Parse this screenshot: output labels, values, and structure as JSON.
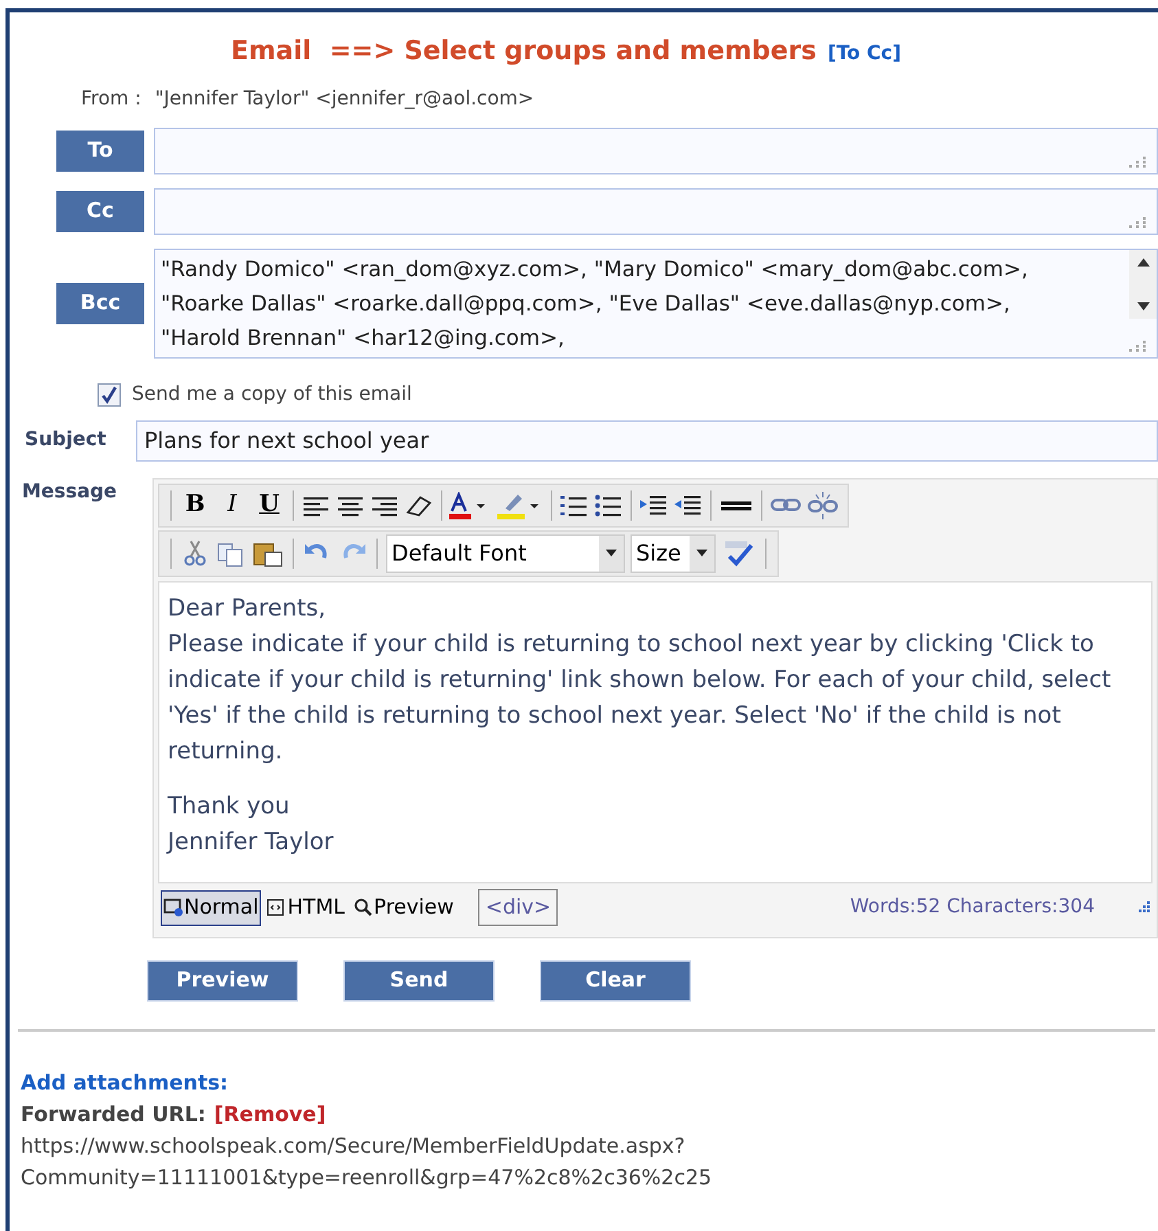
{
  "title": {
    "text": "Email  ==> Select groups and members",
    "link": "[To Cc]"
  },
  "from": {
    "label": "From :",
    "value": "\"Jennifer Taylor\" <jennifer_r@aol.com>"
  },
  "recipients": [
    {
      "label": "To"
    },
    {
      "label": "Cc"
    },
    {
      "label": "Bcc",
      "value": "\"Randy Domico\" <ran_dom@xyz.com>, \"Mary Domico\" <mary_dom@abc.com>, \"Roarke Dallas\" <roarke.dall@ppq.com>, \"Eve Dallas\" <eve.dallas@nyp.com>, \"Harold Brennan\" <har12@ing.com>,"
    }
  ],
  "copy_to_self": {
    "label": "Send me a copy of this email",
    "checked": true
  },
  "subject": {
    "label": "Subject",
    "value": "Plans for next school year"
  },
  "message": {
    "label": "Message",
    "format_buttons": [
      "B",
      "I",
      "U"
    ],
    "font_select": "Default Font",
    "size_select": "Size",
    "body": [
      "Dear Parents,",
      "Please indicate if your child is returning to school next year by clicking 'Click to indicate if your child is returning' link shown below. For each of your child, select 'Yes' if the child is returning to school next year. Select 'No' if the child is not returning.",
      "Thank you\nJennifer Taylor"
    ],
    "modes": [
      {
        "label": "Normal",
        "selected": true
      },
      {
        "label": "HTML",
        "selected": false
      },
      {
        "label": "Preview",
        "selected": false
      }
    ],
    "tag_path": "<div>",
    "counts": "Words:52 Characters:304"
  },
  "buttons": [
    "Preview",
    "Send",
    "Clear"
  ],
  "attachments": {
    "label": "Add attachments:",
    "forwarded_label": "Forwarded URL:",
    "remove_link": "[Remove]",
    "url_lines": [
      "https://www.schoolspeak.com/Secure/MemberFieldUpdate.aspx?",
      "Community=11111001&type=reenroll&grp=47%2c8%2c36%2c25"
    ]
  }
}
